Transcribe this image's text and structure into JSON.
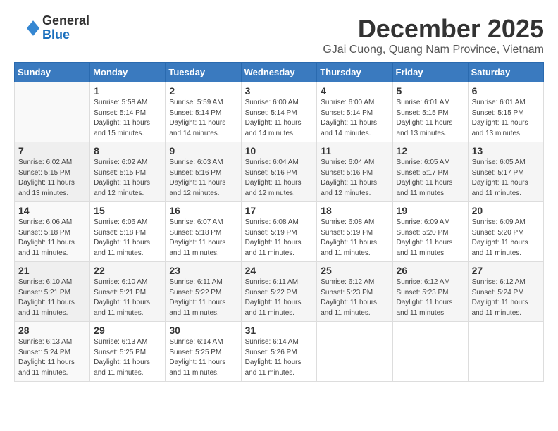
{
  "header": {
    "logo_general": "General",
    "logo_blue": "Blue",
    "month_title": "December 2025",
    "location": "GJai Cuong, Quang Nam Province, Vietnam"
  },
  "weekdays": [
    "Sunday",
    "Monday",
    "Tuesday",
    "Wednesday",
    "Thursday",
    "Friday",
    "Saturday"
  ],
  "weeks": [
    [
      {
        "day": "",
        "info": ""
      },
      {
        "day": "1",
        "info": "Sunrise: 5:58 AM\nSunset: 5:14 PM\nDaylight: 11 hours\nand 15 minutes."
      },
      {
        "day": "2",
        "info": "Sunrise: 5:59 AM\nSunset: 5:14 PM\nDaylight: 11 hours\nand 14 minutes."
      },
      {
        "day": "3",
        "info": "Sunrise: 6:00 AM\nSunset: 5:14 PM\nDaylight: 11 hours\nand 14 minutes."
      },
      {
        "day": "4",
        "info": "Sunrise: 6:00 AM\nSunset: 5:14 PM\nDaylight: 11 hours\nand 14 minutes."
      },
      {
        "day": "5",
        "info": "Sunrise: 6:01 AM\nSunset: 5:15 PM\nDaylight: 11 hours\nand 13 minutes."
      },
      {
        "day": "6",
        "info": "Sunrise: 6:01 AM\nSunset: 5:15 PM\nDaylight: 11 hours\nand 13 minutes."
      }
    ],
    [
      {
        "day": "7",
        "info": "Sunrise: 6:02 AM\nSunset: 5:15 PM\nDaylight: 11 hours\nand 13 minutes."
      },
      {
        "day": "8",
        "info": "Sunrise: 6:02 AM\nSunset: 5:15 PM\nDaylight: 11 hours\nand 12 minutes."
      },
      {
        "day": "9",
        "info": "Sunrise: 6:03 AM\nSunset: 5:16 PM\nDaylight: 11 hours\nand 12 minutes."
      },
      {
        "day": "10",
        "info": "Sunrise: 6:04 AM\nSunset: 5:16 PM\nDaylight: 11 hours\nand 12 minutes."
      },
      {
        "day": "11",
        "info": "Sunrise: 6:04 AM\nSunset: 5:16 PM\nDaylight: 11 hours\nand 12 minutes."
      },
      {
        "day": "12",
        "info": "Sunrise: 6:05 AM\nSunset: 5:17 PM\nDaylight: 11 hours\nand 11 minutes."
      },
      {
        "day": "13",
        "info": "Sunrise: 6:05 AM\nSunset: 5:17 PM\nDaylight: 11 hours\nand 11 minutes."
      }
    ],
    [
      {
        "day": "14",
        "info": "Sunrise: 6:06 AM\nSunset: 5:18 PM\nDaylight: 11 hours\nand 11 minutes."
      },
      {
        "day": "15",
        "info": "Sunrise: 6:06 AM\nSunset: 5:18 PM\nDaylight: 11 hours\nand 11 minutes."
      },
      {
        "day": "16",
        "info": "Sunrise: 6:07 AM\nSunset: 5:18 PM\nDaylight: 11 hours\nand 11 minutes."
      },
      {
        "day": "17",
        "info": "Sunrise: 6:08 AM\nSunset: 5:19 PM\nDaylight: 11 hours\nand 11 minutes."
      },
      {
        "day": "18",
        "info": "Sunrise: 6:08 AM\nSunset: 5:19 PM\nDaylight: 11 hours\nand 11 minutes."
      },
      {
        "day": "19",
        "info": "Sunrise: 6:09 AM\nSunset: 5:20 PM\nDaylight: 11 hours\nand 11 minutes."
      },
      {
        "day": "20",
        "info": "Sunrise: 6:09 AM\nSunset: 5:20 PM\nDaylight: 11 hours\nand 11 minutes."
      }
    ],
    [
      {
        "day": "21",
        "info": "Sunrise: 6:10 AM\nSunset: 5:21 PM\nDaylight: 11 hours\nand 11 minutes."
      },
      {
        "day": "22",
        "info": "Sunrise: 6:10 AM\nSunset: 5:21 PM\nDaylight: 11 hours\nand 11 minutes."
      },
      {
        "day": "23",
        "info": "Sunrise: 6:11 AM\nSunset: 5:22 PM\nDaylight: 11 hours\nand 11 minutes."
      },
      {
        "day": "24",
        "info": "Sunrise: 6:11 AM\nSunset: 5:22 PM\nDaylight: 11 hours\nand 11 minutes."
      },
      {
        "day": "25",
        "info": "Sunrise: 6:12 AM\nSunset: 5:23 PM\nDaylight: 11 hours\nand 11 minutes."
      },
      {
        "day": "26",
        "info": "Sunrise: 6:12 AM\nSunset: 5:23 PM\nDaylight: 11 hours\nand 11 minutes."
      },
      {
        "day": "27",
        "info": "Sunrise: 6:12 AM\nSunset: 5:24 PM\nDaylight: 11 hours\nand 11 minutes."
      }
    ],
    [
      {
        "day": "28",
        "info": "Sunrise: 6:13 AM\nSunset: 5:24 PM\nDaylight: 11 hours\nand 11 minutes."
      },
      {
        "day": "29",
        "info": "Sunrise: 6:13 AM\nSunset: 5:25 PM\nDaylight: 11 hours\nand 11 minutes."
      },
      {
        "day": "30",
        "info": "Sunrise: 6:14 AM\nSunset: 5:25 PM\nDaylight: 11 hours\nand 11 minutes."
      },
      {
        "day": "31",
        "info": "Sunrise: 6:14 AM\nSunset: 5:26 PM\nDaylight: 11 hours\nand 11 minutes."
      },
      {
        "day": "",
        "info": ""
      },
      {
        "day": "",
        "info": ""
      },
      {
        "day": "",
        "info": ""
      }
    ]
  ]
}
